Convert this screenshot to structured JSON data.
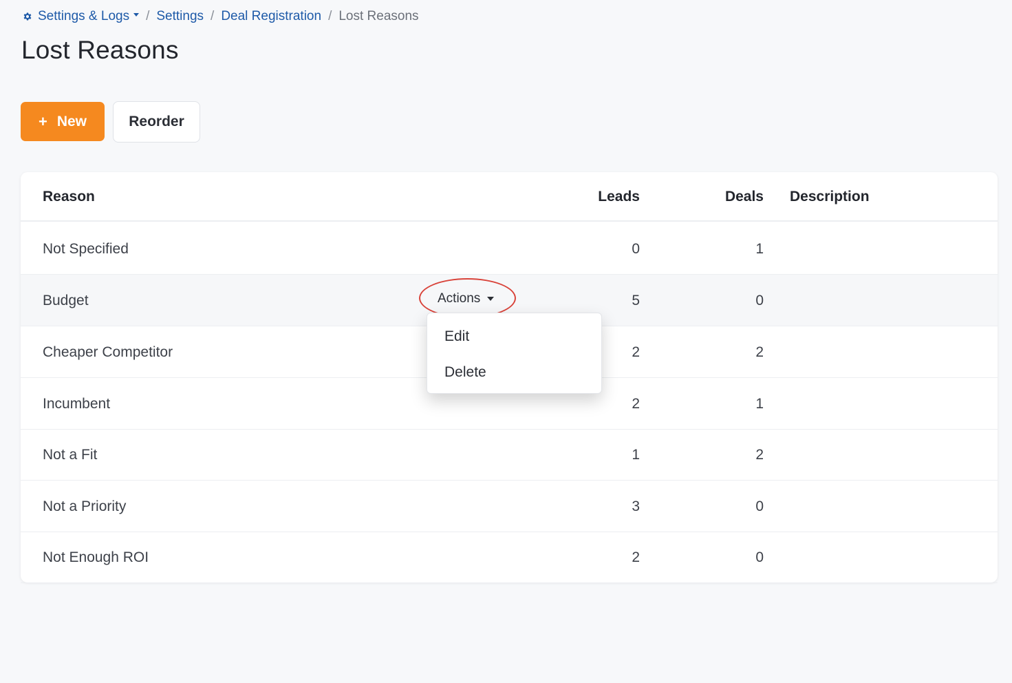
{
  "breadcrumb": {
    "settings_logs": "Settings & Logs",
    "settings": "Settings",
    "deal_registration": "Deal Registration",
    "current": "Lost Reasons",
    "separator": "/"
  },
  "page_title": "Lost Reasons",
  "toolbar": {
    "new_label": "New",
    "new_icon": "+",
    "reorder_label": "Reorder"
  },
  "table": {
    "columns": {
      "reason": "Reason",
      "leads": "Leads",
      "deals": "Deals",
      "description": "Description"
    },
    "rows": [
      {
        "reason": "Not Specified",
        "leads": "0",
        "deals": "1",
        "description": ""
      },
      {
        "reason": "Budget",
        "leads": "5",
        "deals": "0",
        "description": ""
      },
      {
        "reason": "Cheaper Competitor",
        "leads": "2",
        "deals": "2",
        "description": ""
      },
      {
        "reason": "Incumbent",
        "leads": "2",
        "deals": "1",
        "description": ""
      },
      {
        "reason": "Not a Fit",
        "leads": "1",
        "deals": "2",
        "description": ""
      },
      {
        "reason": "Not a Priority",
        "leads": "3",
        "deals": "0",
        "description": ""
      },
      {
        "reason": "Not Enough ROI",
        "leads": "2",
        "deals": "0",
        "description": ""
      }
    ]
  },
  "actions": {
    "label": "Actions",
    "menu": {
      "edit": "Edit",
      "delete": "Delete"
    }
  },
  "colors": {
    "accent": "#f5891f",
    "link": "#1e5aa8",
    "highlight": "#d9433a"
  },
  "icons": {
    "breadcrumb_root": "gear-icon",
    "new": "plus-icon",
    "actions": "caret-down-icon"
  }
}
